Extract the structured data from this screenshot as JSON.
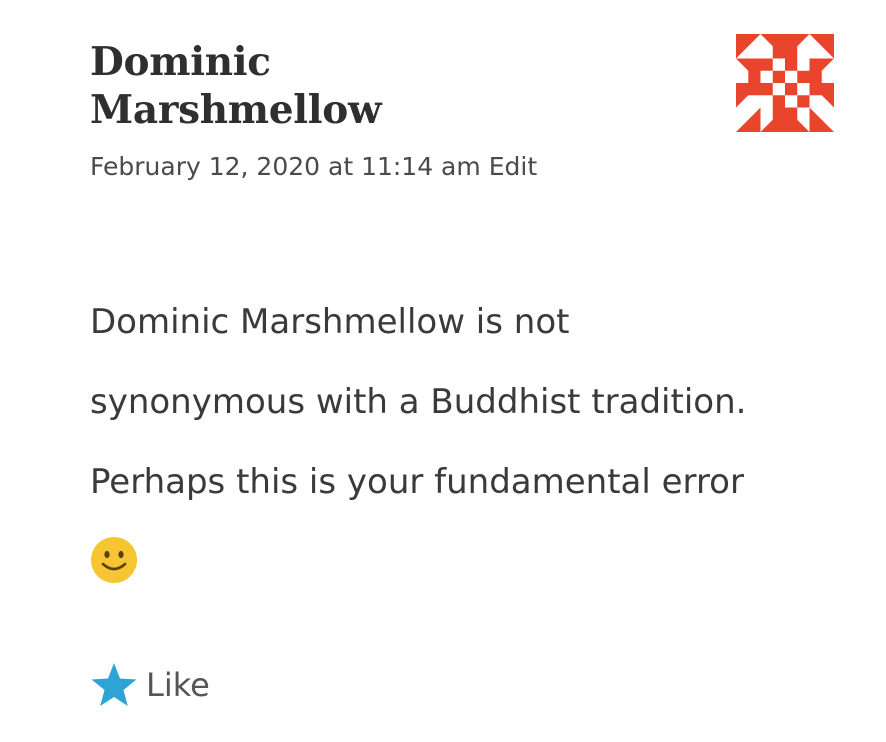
{
  "comment": {
    "author": {
      "line1": "Dominic",
      "line2": "Marshmellow"
    },
    "timestamp": "February 12, 2020 at 11:14 am",
    "edit_label": "Edit",
    "body_lines": [
      "Dominic Marshmellow is not",
      "synonymous with a Buddhist tradition.",
      "Perhaps this is your fundamental error"
    ],
    "emoji": "slightly-smiling-face-icon",
    "like_label": "Like"
  },
  "icons": {
    "avatar": "identicon-avatar",
    "like": "star-icon"
  },
  "colors": {
    "avatar_fill": "#e8452c",
    "star_fill": "#2ea3d6",
    "emoji_fill": "#f7c531"
  }
}
